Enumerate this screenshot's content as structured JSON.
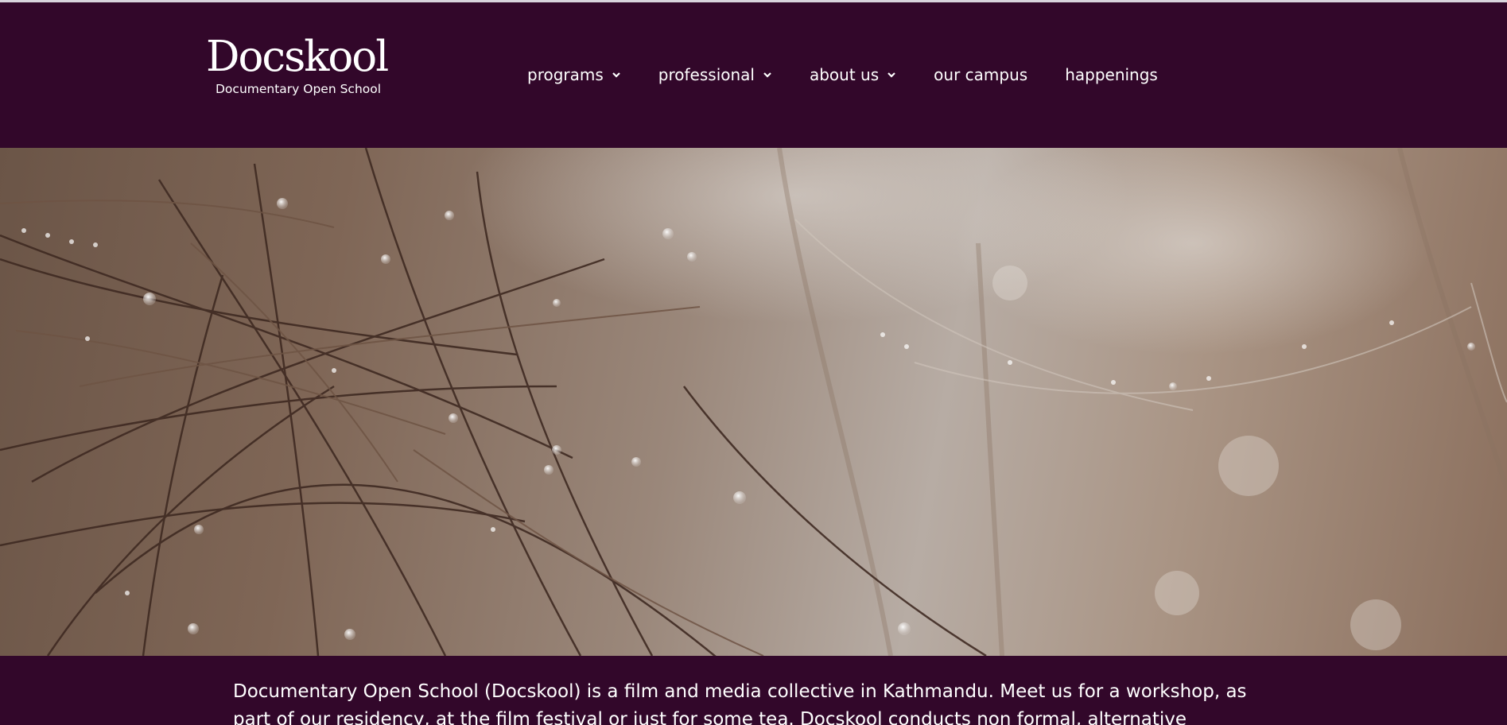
{
  "header": {
    "logo": {
      "name": "Docskool",
      "tagline": "Documentary Open School"
    },
    "nav": [
      {
        "label": "programs",
        "has_dropdown": true
      },
      {
        "label": "professional",
        "has_dropdown": true
      },
      {
        "label": "about us",
        "has_dropdown": true
      },
      {
        "label": "our campus",
        "has_dropdown": false
      },
      {
        "label": "happenings",
        "has_dropdown": false
      }
    ]
  },
  "hero": {
    "icon": "dewy-grass-photo"
  },
  "intro": {
    "text": "Documentary Open School (Docskool) is a film and media collective in Kathmandu. Meet us for a workshop, as part of our residency, at the film festival or just for some tea. Docskool conducts non formal, alternative"
  },
  "colors": {
    "brand": "#32072a",
    "text": "#ffffff"
  }
}
